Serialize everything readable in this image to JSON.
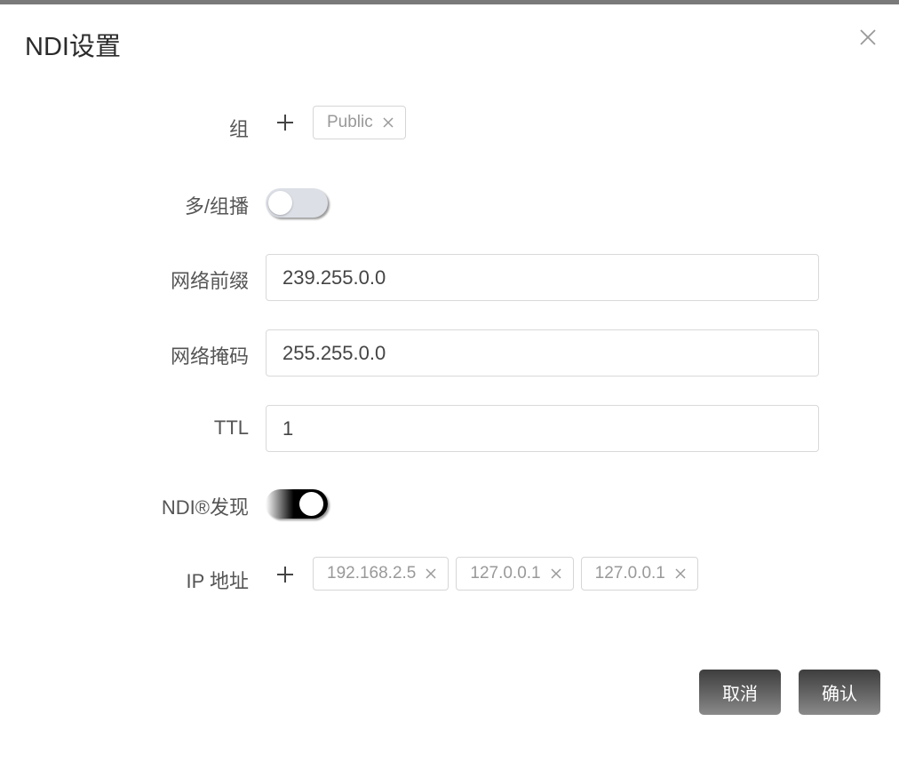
{
  "dialog": {
    "title": "NDI设置",
    "close_icon": "close-icon"
  },
  "group": {
    "label": "组",
    "add_icon": "plus-icon",
    "tags": [
      {
        "label": "Public"
      }
    ]
  },
  "multicast": {
    "label": "多/组播",
    "enabled": false
  },
  "network_prefix": {
    "label": "网络前缀",
    "value": "239.255.0.0"
  },
  "network_mask": {
    "label": "网络掩码",
    "value": "255.255.0.0"
  },
  "ttl": {
    "label": "TTL",
    "value": "1"
  },
  "discovery": {
    "label": "NDI®发现",
    "enabled": true
  },
  "ip_address": {
    "label": "IP 地址",
    "add_icon": "plus-icon",
    "tags": [
      {
        "label": "192.168.2.5"
      },
      {
        "label": "127.0.0.1"
      },
      {
        "label": "127.0.0.1"
      }
    ]
  },
  "footer": {
    "cancel_label": "取消",
    "confirm_label": "确认"
  },
  "colors": {
    "switch_off": "#dcdfe6",
    "switch_on": "#000000",
    "button": "#5a5a5a"
  }
}
